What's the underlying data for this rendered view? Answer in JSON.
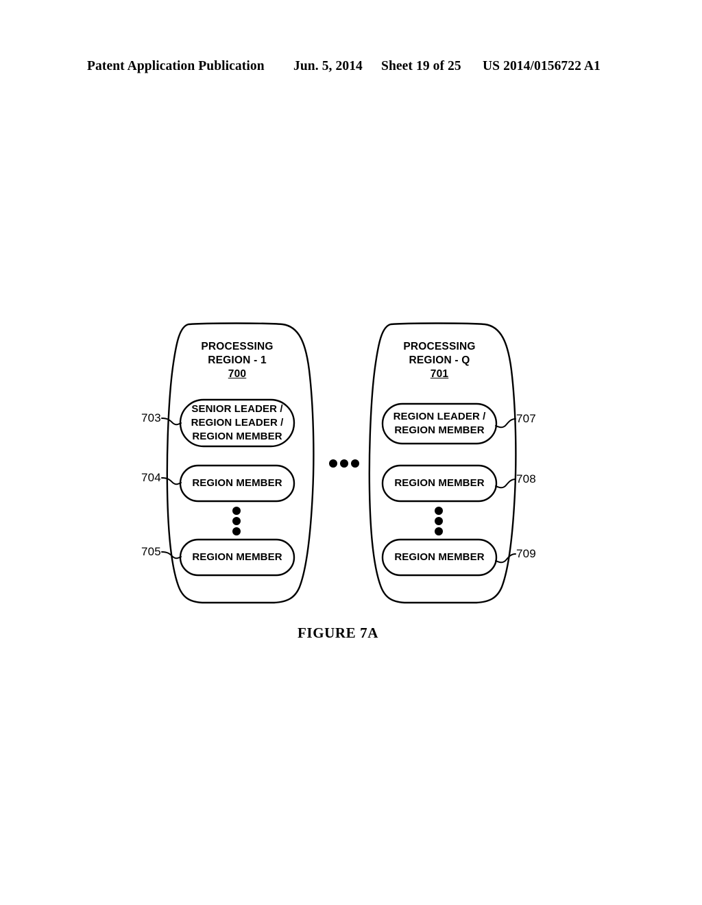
{
  "header": {
    "publication": "Patent Application Publication",
    "date": "Jun. 5, 2014",
    "sheet": "Sheet 19 of 25",
    "patent_number": "US 2014/0156722 A1"
  },
  "figure": {
    "caption": "FIGURE 7A",
    "horizontal_ellipsis": "•••",
    "regions": [
      {
        "id": "region-1",
        "title_line1": "PROCESSING",
        "title_line2": "REGION - 1",
        "ref": "700",
        "vertical_ellipsis": "⋮",
        "nodes": [
          {
            "id": "node-703",
            "ref": "703",
            "ref_side": "left",
            "lines": [
              "SENIOR LEADER /",
              "REGION LEADER /",
              "REGION MEMBER"
            ]
          },
          {
            "id": "node-704",
            "ref": "704",
            "ref_side": "left",
            "lines": [
              "REGION MEMBER"
            ]
          },
          {
            "id": "node-705",
            "ref": "705",
            "ref_side": "left",
            "lines": [
              "REGION MEMBER"
            ]
          }
        ]
      },
      {
        "id": "region-q",
        "title_line1": "PROCESSING",
        "title_line2": "REGION - Q",
        "ref": "701",
        "vertical_ellipsis": "⋮",
        "nodes": [
          {
            "id": "node-707",
            "ref": "707",
            "ref_side": "right",
            "lines": [
              "REGION LEADER /",
              "REGION MEMBER"
            ]
          },
          {
            "id": "node-708",
            "ref": "708",
            "ref_side": "right",
            "lines": [
              "REGION MEMBER"
            ]
          },
          {
            "id": "node-709",
            "ref": "709",
            "ref_side": "right",
            "lines": [
              "REGION MEMBER"
            ]
          }
        ]
      }
    ]
  },
  "colors": {
    "ink": "#000000",
    "paper": "#ffffff"
  }
}
